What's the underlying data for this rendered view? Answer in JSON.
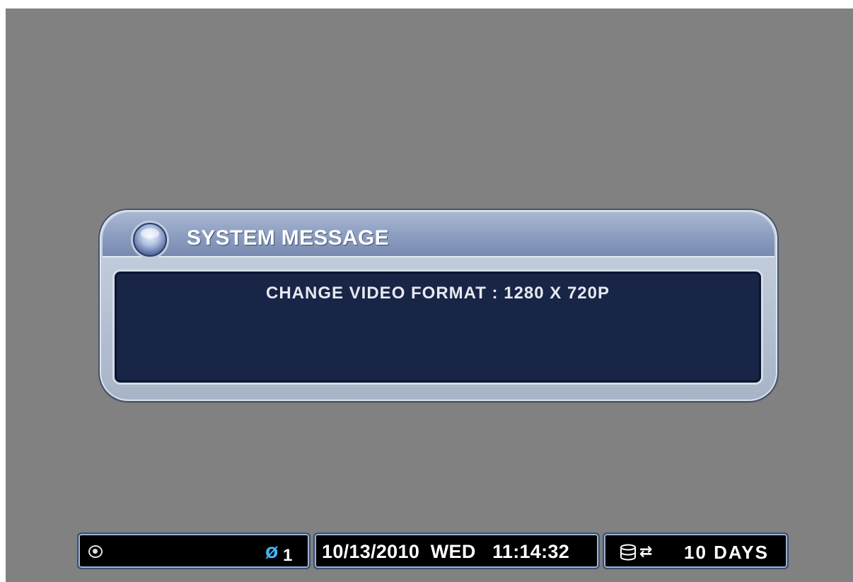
{
  "dialog": {
    "title": "SYSTEM MESSAGE",
    "message": "CHANGE VIDEO FORMAT : 1280 X 720P"
  },
  "statusbar": {
    "camera": {
      "view_icon": "eye-icon",
      "camera_icon": "camera-off-icon",
      "camera_number": "1"
    },
    "clock": {
      "date": "10/13/2010",
      "day": "WED",
      "time": "11:14:32"
    },
    "disk": {
      "hdd_icon": "hdd-icon",
      "cycle_icon": "recycle-icon",
      "days": "10 DAYS"
    }
  },
  "colors": {
    "background": "#818181",
    "dialog_body": "#182547",
    "accent_icon": "#44b4ee"
  }
}
